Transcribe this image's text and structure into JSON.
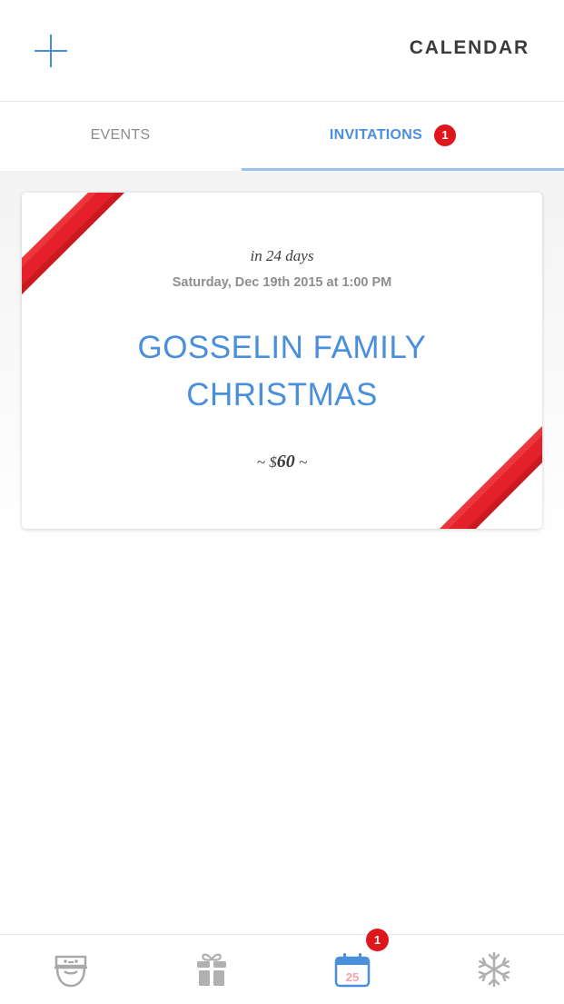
{
  "header": {
    "title": "CALENDAR",
    "add_icon": "plus-icon"
  },
  "tabs": [
    {
      "label": "EVENTS",
      "active": false
    },
    {
      "label": "INVITATIONS",
      "active": true,
      "badge": "1"
    }
  ],
  "invitation": {
    "relative_time": "in 24 days",
    "datetime": "Saturday, Dec 19th 2015 at 1:00 PM",
    "title_line1": "GOSSELIN FAMILY",
    "title_line2": "CHRISTMAS",
    "price_prefix": "~ $",
    "price_amount": "60",
    "price_suffix": " ~"
  },
  "bottom_nav": {
    "items": [
      {
        "icon": "santa-icon"
      },
      {
        "icon": "gift-icon"
      },
      {
        "icon": "calendar-icon",
        "day": "25",
        "badge": "1",
        "active": true
      },
      {
        "icon": "snowflake-icon"
      }
    ]
  },
  "colors": {
    "accent": "#4a8fdc",
    "badge": "#e0161d",
    "ribbon": "#e0161d",
    "muted": "#8c8c8c"
  }
}
